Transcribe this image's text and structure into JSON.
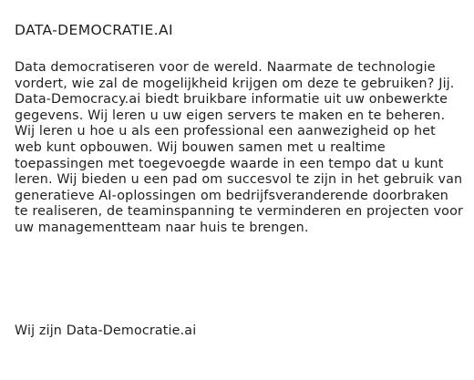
{
  "header": {
    "title": "DATA-DEMOCRATIE.AI"
  },
  "content": {
    "intro": "Data democratiseren voor de wereld. Naarmate de technologie vordert, wie zal de mogelijkheid krijgen om deze te gebruiken? Jij. Data-Democracy.ai biedt bruikbare informatie uit uw onbewerkte gegevens. Wij leren u uw eigen servers te maken en te beheren. Wij leren u hoe u als een professional een aanwezigheid op het web kunt opbouwen. Wij bouwen samen met u realtime toepassingen met toegevoegde waarde in een tempo dat u kunt leren. Wij bieden u een pad om succesvol te zijn in het gebruik van generatieve AI-oplossingen om bedrijfsveranderende doorbraken te realiseren, de teaminspanning te verminderen en projecten voor uw managementteam naar huis te brengen.",
    "closing": "Wij zijn Data-Democratie.ai"
  }
}
